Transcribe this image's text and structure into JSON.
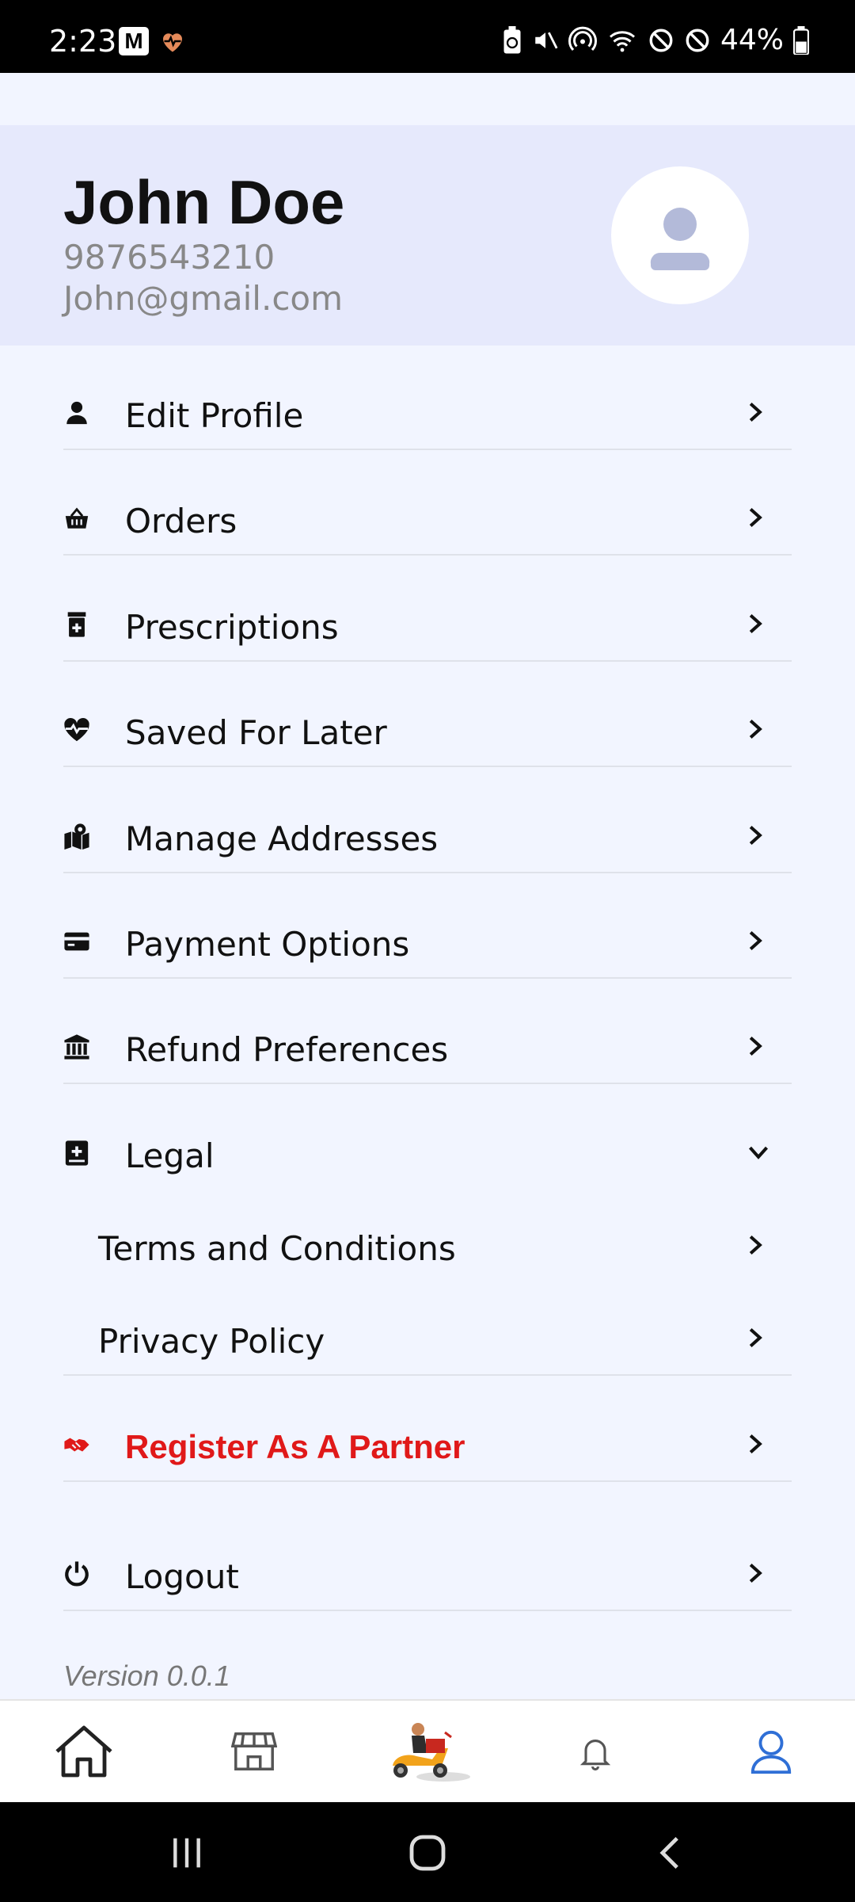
{
  "status_bar": {
    "time": "2:23",
    "left_app_badge": "M",
    "battery_percent": "44%",
    "icons": [
      "gmail-m-icon",
      "heart-health-icon",
      "battery-saver-icon",
      "mute-icon",
      "hotspot-icon",
      "wifi-icon",
      "block-icon",
      "block-icon",
      "battery-icon"
    ]
  },
  "profile": {
    "name": "John Doe",
    "phone": "9876543210",
    "email": "John@gmail.com",
    "avatar_icon": "user-avatar-icon"
  },
  "menu": {
    "items": [
      {
        "label": "Edit Profile",
        "icon": "person-icon"
      },
      {
        "label": "Orders",
        "icon": "basket-icon"
      },
      {
        "label": "Prescriptions",
        "icon": "prescription-bottle-icon"
      },
      {
        "label": "Saved For Later",
        "icon": "heart-pulse-icon"
      },
      {
        "label": "Manage Addresses",
        "icon": "map-location-icon"
      },
      {
        "label": "Payment Options",
        "icon": "credit-card-icon"
      },
      {
        "label": "Refund Preferences",
        "icon": "bank-icon"
      },
      {
        "label": "Legal",
        "icon": "medical-book-icon",
        "expanded": true
      }
    ],
    "legal_subitems": [
      {
        "label": "Terms and Conditions"
      },
      {
        "label": "Privacy Policy"
      }
    ],
    "partner": {
      "label": "Register As A Partner",
      "icon": "handshake-icon",
      "color": "#e01919"
    },
    "logout": {
      "label": "Logout",
      "icon": "power-icon"
    }
  },
  "version": "Version 0.0.1",
  "bottom_nav": {
    "items": [
      "home-icon",
      "store-icon",
      "delivery-scooter-icon",
      "bell-icon",
      "profile-icon"
    ],
    "active": "profile-icon",
    "active_color": "#2f6fd6"
  },
  "colors": {
    "background": "#f2f5ff",
    "header_background": "#e6e9fc",
    "accent_red": "#e01919"
  }
}
